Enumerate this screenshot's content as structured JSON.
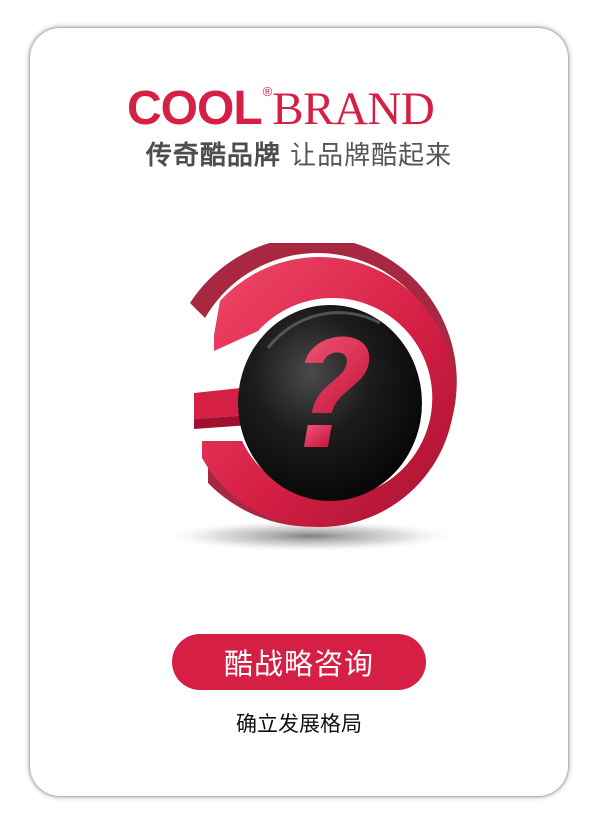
{
  "logo": {
    "word_cool": "COOL",
    "registered_mark": "®",
    "word_brand": "BRAND"
  },
  "tagline": {
    "primary": "传奇酷品牌",
    "secondary": "让品牌酷起来"
  },
  "emblem": {
    "glyph": "?",
    "icon": "question-mark-icon"
  },
  "cta": {
    "label": "酷战略咨询"
  },
  "subtitle": "确立发展格局",
  "colors": {
    "brand_red": "#d61f45",
    "dark_disc": "#1a1a1a",
    "tagline_gray": "#555555"
  }
}
